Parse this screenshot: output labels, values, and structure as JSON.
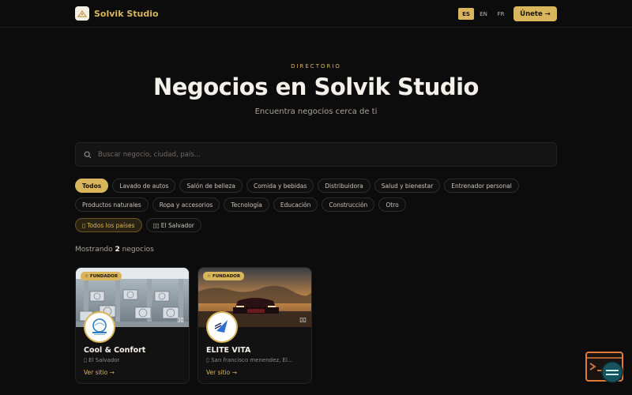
{
  "header": {
    "brand": "Solvik Studio",
    "languages": [
      {
        "label": "ES",
        "active": true
      },
      {
        "label": "EN",
        "active": false
      },
      {
        "label": "FR",
        "active": false
      }
    ],
    "join_label": "Únete →"
  },
  "hero": {
    "eyebrow": "DIRECTORIO",
    "title": "Negocios en Solvik Studio",
    "subtitle": "Encuentra negocios cerca de ti"
  },
  "search": {
    "placeholder": "Buscar negocio, ciudad, país..."
  },
  "categories": [
    "Todos",
    "Lavado de autos",
    "Salón de belleza",
    "Comida y bebidas",
    "Distribuidora",
    "Salud y bienestar",
    "Entrenador personal",
    "Productos naturales",
    "Ropa y accesorios",
    "Tecnología",
    "Educación",
    "Construcción",
    "Otro"
  ],
  "countries": [
    "Todos los países",
    "El Salvador"
  ],
  "results": {
    "prefix": "Mostrando",
    "count": "2",
    "suffix": "negocios"
  },
  "businesses": [
    {
      "badge": "FUNDADOR",
      "name": "Cool & Confort",
      "location": "El Salvador",
      "link": "Ver sitio →"
    },
    {
      "badge": "FUNDADOR",
      "name": "ELITE VITA",
      "location": "San francisco menendez, El...",
      "link": "Ver sitio →"
    }
  ],
  "colors": {
    "background": "#0c0c0c",
    "accent": "#d9b65b",
    "text": "#f4f1ea"
  }
}
